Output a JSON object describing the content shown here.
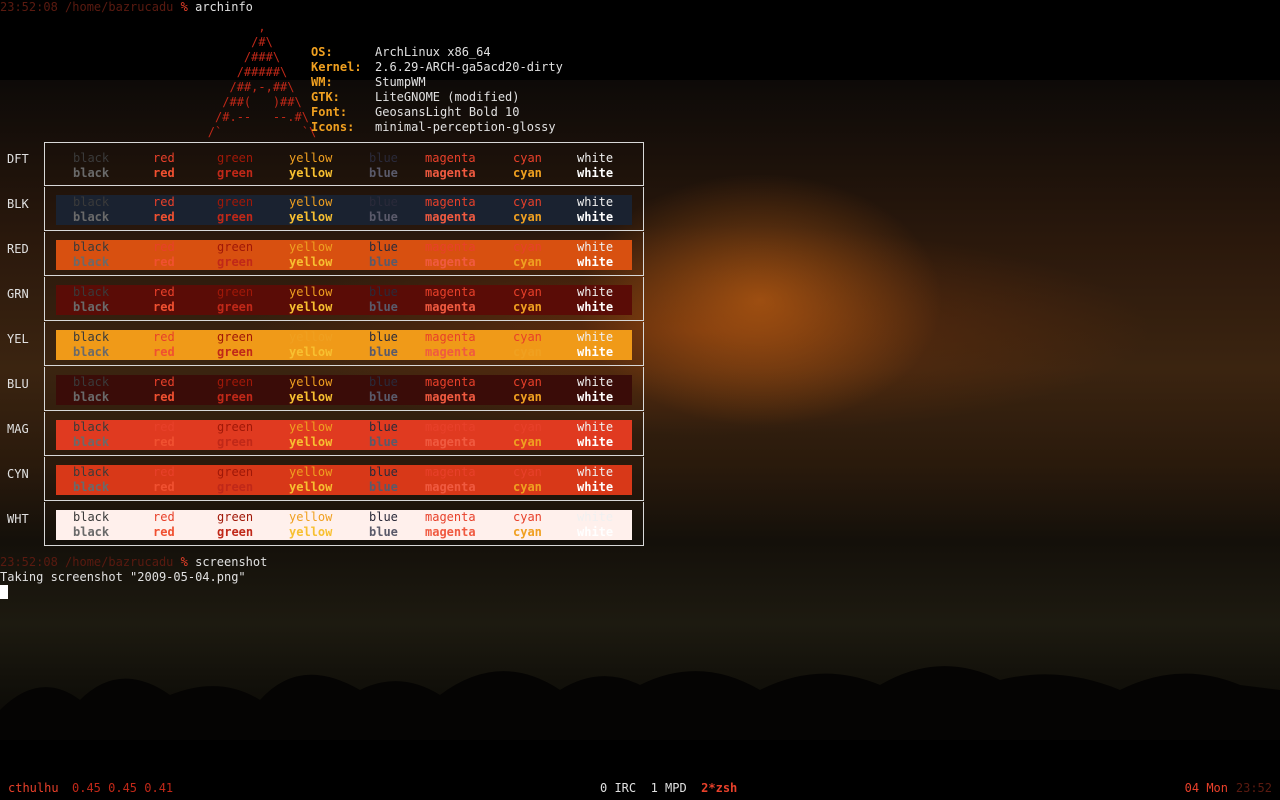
{
  "terminal": {
    "prompt1": {
      "time": "23:52:08",
      "path": "/home/bazrucadu",
      "symbol": "%",
      "command": "archinfo"
    },
    "logo_ascii": "               ,\n              /#\\\n             /###\\\n            /#####\\\n           /##,-,##\\\n          /##(   )##\\\n         /#.--   --.#\\\n        /`           `\\",
    "sysinfo": [
      {
        "key": "OS:",
        "value": "ArchLinux x86_64"
      },
      {
        "key": "Kernel:",
        "value": "2.6.29-ARCH-ga5acd20-dirty"
      },
      {
        "key": "WM:",
        "value": "StumpWM"
      },
      {
        "key": "GTK:",
        "value": "LiteGNOME (modified)"
      },
      {
        "key": "Font:",
        "value": "GeosansLight Bold 10"
      },
      {
        "key": "Icons:",
        "value": "minimal-perception-glossy"
      }
    ],
    "color_names": [
      "black",
      "red",
      "green",
      "yellow",
      "blue",
      "magenta",
      "cyan",
      "white"
    ],
    "palette": [
      {
        "label": "DFT",
        "bg": "none"
      },
      {
        "label": "BLK",
        "bg": "#1a2230"
      },
      {
        "label": "RED",
        "bg": "#d85010"
      },
      {
        "label": "GRN",
        "bg": "#5a0c06"
      },
      {
        "label": "YEL",
        "bg": "#f09a18"
      },
      {
        "label": "BLU",
        "bg": "#3a0c08"
      },
      {
        "label": "MAG",
        "bg": "#e03a20"
      },
      {
        "label": "CYN",
        "bg": "#d83818"
      },
      {
        "label": "WHT",
        "bg": "#fff0ec"
      }
    ],
    "fg_colors": {
      "normal": [
        "#3a3a3a",
        "#e8402a",
        "#a01808",
        "#f0a020",
        "#2a2a3a",
        "#e8402a",
        "#e8402a",
        "#f0f0f0"
      ],
      "bold": [
        "#6a6a6a",
        "#f05030",
        "#c02818",
        "#f8c030",
        "#5a5a6a",
        "#f05a40",
        "#f0a020",
        "#ffffff"
      ]
    },
    "prompt2": {
      "time": "23:52:08",
      "path": "/home/bazrucadu",
      "symbol": "%",
      "command": "screenshot"
    },
    "output": "Taking screenshot \"2009-05-04.png\""
  },
  "statusbar": {
    "hostname": "cthulhu",
    "load": "0.45 0.45 0.41",
    "windows": "0 IRC  1 MPD  ",
    "active_window": "2*zsh",
    "date": "04 Mon",
    "time": "23:52"
  }
}
